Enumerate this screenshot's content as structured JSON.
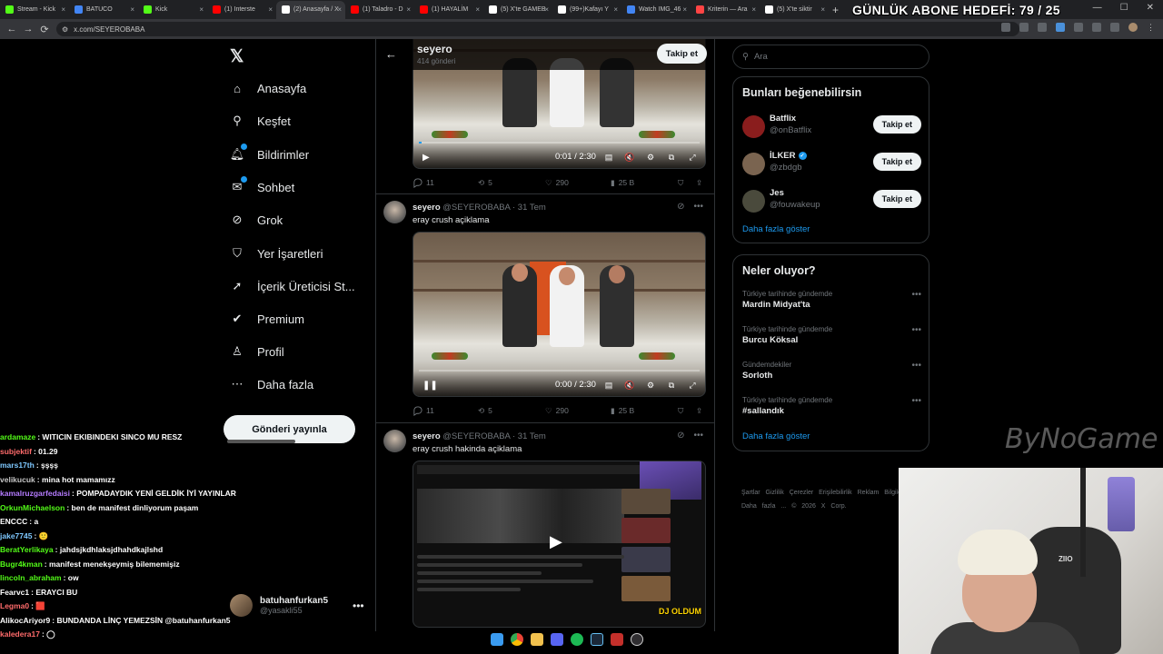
{
  "browser": {
    "tabs": [
      {
        "label": "Stream - Kick",
        "color": "#53fc18"
      },
      {
        "label": "BATUCO",
        "color": "#4285f4"
      },
      {
        "label": "Kick",
        "color": "#53fc18"
      },
      {
        "label": "(1) Interste",
        "color": "#ff0000"
      },
      {
        "label": "(2) Anasayfa / X",
        "color": "#ffffff"
      },
      {
        "label": "(1) Taladro - D",
        "color": "#ff0000"
      },
      {
        "label": "(1) HAYALİM",
        "color": "#ff0000"
      },
      {
        "label": "(5) X'te GAMEB",
        "color": "#ffffff"
      },
      {
        "label": "(99+)Kafayı Y",
        "color": "#ffffff"
      },
      {
        "label": "Watch IMG_46",
        "color": "#4285f4"
      },
      {
        "label": "Kriterin — Ara",
        "color": "#ff4444"
      },
      {
        "label": "(5) X'te siktir",
        "color": "#ffffff"
      }
    ],
    "url": "x.com/SEYEROBABA",
    "goal_overlay": "GÜNLÜK ABONE HEDEFİ: 79 / 25"
  },
  "nav": {
    "items": [
      {
        "label": "Anasayfa",
        "icon": "home-icon"
      },
      {
        "label": "Keşfet",
        "icon": "search-icon"
      },
      {
        "label": "Bildirimler",
        "icon": "bell-icon"
      },
      {
        "label": "Sohbet",
        "icon": "chat-icon"
      },
      {
        "label": "Grok",
        "icon": "grok-icon"
      },
      {
        "label": "Yer İşaretleri",
        "icon": "bookmark-icon"
      },
      {
        "label": "İçerik Üreticisi St...",
        "icon": "rocket-icon"
      },
      {
        "label": "Premium",
        "icon": "premium-icon"
      },
      {
        "label": "Profil",
        "icon": "profile-icon"
      },
      {
        "label": "Daha fazla",
        "icon": "more-circle-icon"
      }
    ],
    "post_button": "Gönderi yayınla",
    "account": {
      "name": "batuhanfurkan5",
      "handle": "@yasakli55"
    }
  },
  "chat": [
    {
      "user": "ardamaze",
      "color": "#53fc18",
      "msg": "WITICIN EKIBINDEKI SINCO MU RESZ"
    },
    {
      "user": "subjektif",
      "color": "#ff6b6b",
      "msg": "01.29"
    },
    {
      "user": "mars17th",
      "color": "#7ec8ff",
      "msg": "şşşş"
    },
    {
      "user": "velikucuk",
      "color": "#c6c6c6",
      "msg": "mina hot mamamızz"
    },
    {
      "user": "kamalruzgarfedaisi",
      "color": "#b57bff",
      "msg": "POMPADAYDIK YENİ GELDİK İYİ YAYINLAR"
    },
    {
      "user": "OrkunMichaelson",
      "color": "#53fc18",
      "msg": "ben de manifest dinliyorum paşam"
    },
    {
      "user": "ENCCC",
      "color": "#ffffff",
      "msg": "a"
    },
    {
      "user": "jake7745",
      "color": "#7ec8ff",
      "msg": "🙂"
    },
    {
      "user": "BeratYerlikaya",
      "color": "#53fc18",
      "msg": "jahdsjkdhlaksjdhahdkajlshd"
    },
    {
      "user": "Bugr4kman",
      "color": "#53fc18",
      "msg": "manifest menekşeymiş bilememişiz"
    },
    {
      "user": "lincoln_abraham",
      "color": "#53fc18",
      "msg": "ow"
    },
    {
      "user": "Fearvc1",
      "color": "#ffffff",
      "msg": "ERAYCI BU"
    },
    {
      "user": "Legma0",
      "color": "#ff6b6b",
      "msg": "🟥"
    },
    {
      "user": "AlikocAriyor9",
      "color": "#ffffff",
      "msg": "BUNDANDA LİNÇ YEMEZSİN @batuhanfurkan5"
    },
    {
      "user": "kaledera17",
      "color": "#ff6b6b",
      "msg": "◯"
    }
  ],
  "profile": {
    "name": "seyero",
    "posts": "414 gönderi",
    "follow": "Takip et"
  },
  "video1": {
    "time": "0:01 / 2:30",
    "progress": 0.01,
    "stats": {
      "replies": "11",
      "reposts": "5",
      "likes": "290",
      "views": "25 B"
    }
  },
  "tweet2": {
    "name": "seyero",
    "handle": "@SEYEROBABA",
    "date": "· 31 Tem",
    "text": "eray crush açiklama",
    "time": "0:00 / 2:30",
    "progress": 0.0,
    "stats": {
      "replies": "11",
      "reposts": "5",
      "likes": "290",
      "views": "25 B"
    }
  },
  "tweet3": {
    "name": "seyero",
    "handle": "@SEYEROBABA",
    "date": "· 31 Tem",
    "text": "eray crush hakinda açiklama",
    "overlay_text": "DJ OLDUM"
  },
  "search": {
    "placeholder": "Ara"
  },
  "who_to_follow": {
    "title": "Bunları beğenebilirsin",
    "users": [
      {
        "name": "Batflix",
        "handle": "@onBatflix",
        "verified": false,
        "color": "#8a1d1d"
      },
      {
        "name": "İLKER",
        "handle": "@zbdgb",
        "verified": true,
        "color": "#7a6450"
      },
      {
        "name": "Jes",
        "handle": "@fouwakeup",
        "verified": false,
        "color": "#4a4a3c"
      }
    ],
    "follow_label": "Takip et",
    "show_more": "Daha fazla göster"
  },
  "trends": {
    "title": "Neler oluyor?",
    "items": [
      {
        "category": "Türkiye tarihinde gündemde",
        "title": "Mardin Midyat'ta"
      },
      {
        "category": "Türkiye tarihinde gündemde",
        "title": "Burcu Köksal"
      },
      {
        "category": "Gündemdekiler",
        "title": "Sorloth"
      },
      {
        "category": "Türkiye tarihinde gündemde",
        "title": "#sallandık"
      }
    ],
    "show_more": "Daha fazla göster"
  },
  "footer": "Şartlar  Gizlilik  Çerezler  Erişilebilirlik  Reklam Bilgileri  Daha fazla ...  © 2026 X Corp.",
  "watermark": "ByNoGame",
  "webcam": {
    "cap_text": "ZIIO"
  }
}
